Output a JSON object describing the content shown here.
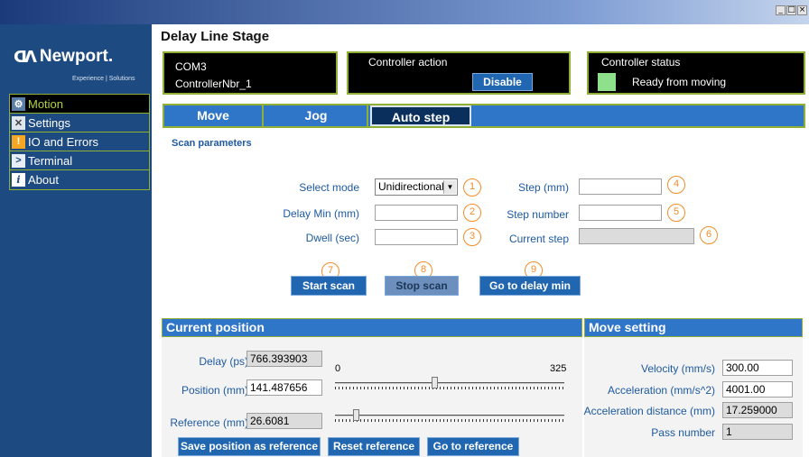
{
  "window": {
    "controls": [
      "_",
      "□",
      "×"
    ]
  },
  "sidebar": {
    "logo_mark": "ᗡᐱ",
    "logo_text": "Newport.",
    "logo_tagline": "Experience | Solutions",
    "items": [
      {
        "label": "Motion",
        "icon": "gear-icon",
        "active": true
      },
      {
        "label": "Settings",
        "icon": "tools-icon",
        "active": false
      },
      {
        "label": "IO and Errors",
        "icon": "warning-icon",
        "active": false
      },
      {
        "label": "Terminal",
        "icon": "terminal-icon",
        "active": false
      },
      {
        "label": "About",
        "icon": "info-icon",
        "active": false
      }
    ]
  },
  "header": {
    "title": "Delay Line Stage"
  },
  "connection": {
    "port": "COM3",
    "controller": "ControllerNbr_1"
  },
  "controller_action": {
    "label": "Controller action",
    "button": "Disable"
  },
  "controller_status": {
    "label": "Controller status",
    "state": "Ready from moving",
    "led_color": "#8fe08a"
  },
  "tabs": [
    {
      "label": "Move",
      "active": false
    },
    {
      "label": "Jog",
      "active": false
    },
    {
      "label": "Auto step",
      "active": true
    }
  ],
  "scan": {
    "title": "Scan parameters",
    "select_mode_label": "Select mode",
    "select_mode_value": "Unidirectional",
    "delay_min_label": "Delay Min (mm)",
    "delay_min_value": "",
    "dwell_label": "Dwell (sec)",
    "dwell_value": "",
    "step_label": "Step (mm)",
    "step_value": "",
    "step_number_label": "Step number",
    "step_number_value": "",
    "current_step_label": "Current step",
    "current_step_value": "",
    "markers": [
      "1",
      "2",
      "3",
      "4",
      "5",
      "6",
      "7",
      "8",
      "9"
    ],
    "start_button": "Start scan",
    "stop_button": "Stop scan",
    "goto_min_button": "Go to delay min"
  },
  "current_position": {
    "title": "Current position",
    "delay_label": "Delay (ps)",
    "delay_value": "766.393903",
    "position_label": "Position (mm)",
    "position_value": "141.487656",
    "reference_label": "Reference (mm)",
    "reference_value": "26.6081",
    "scale_min": "0",
    "scale_max": "325",
    "position_slider_fraction": 0.435,
    "reference_slider_fraction": 0.082,
    "save_button": "Save position as reference",
    "reset_button": "Reset reference",
    "goto_button": "Go to reference"
  },
  "move_setting": {
    "title": "Move setting",
    "velocity_label": "Velocity (mm/s)",
    "velocity_value": "300.00",
    "acceleration_label": "Acceleration (mm/s^2)",
    "acceleration_value": "4001.00",
    "accel_distance_label": "Acceleration distance (mm)",
    "accel_distance_value": "17.259000",
    "pass_number_label": "Pass number",
    "pass_number_value": "1"
  },
  "colors": {
    "accent_green": "#8fb034",
    "nav_blue": "#1d4a80",
    "button_blue": "#2066b0",
    "marker_orange": "#f28c28"
  }
}
